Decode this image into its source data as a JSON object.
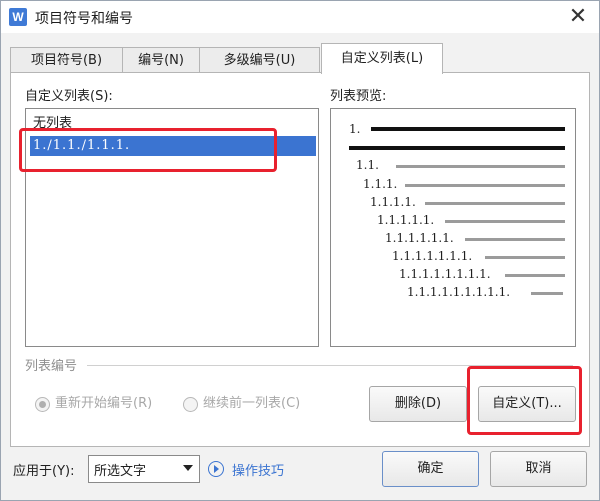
{
  "window": {
    "title": "项目符号和编号",
    "app_icon_letter": "W",
    "close_symbol": "✕"
  },
  "tabs": [
    {
      "label": "项目符号(B)"
    },
    {
      "label": "编号(N)"
    },
    {
      "label": "多级编号(U)"
    },
    {
      "label": "自定义列表(L)",
      "active": true
    }
  ],
  "custom_list": {
    "label": "自定义列表(S):",
    "items": [
      {
        "text": "无列表",
        "selected": false
      },
      {
        "text": "1./1.1./1.1.1.",
        "selected": true
      }
    ]
  },
  "preview": {
    "label": "列表预览:",
    "lines": [
      "1.",
      "",
      "1.1.",
      "1.1.1.",
      "1.1.1.1.",
      "1.1.1.1.1.",
      "1.1.1.1.1.1.",
      "1.1.1.1.1.1.1.",
      "1.1.1.1.1.1.1.1.",
      "1.1.1.1.1.1.1.1.1."
    ]
  },
  "list_numbering": {
    "label": "列表编号",
    "restart_label": "重新开始编号(R)",
    "continue_label": "继续前一列表(C)",
    "restart_checked": true,
    "disabled": true
  },
  "buttons": {
    "delete": "删除(D)",
    "customize": "自定义(T)...",
    "ok": "确定",
    "cancel": "取消"
  },
  "apply_to": {
    "label": "应用于(Y):",
    "value": "所选文字"
  },
  "tips_link": "操作技巧",
  "colors": {
    "highlight": "#e8212e",
    "selection": "#3b74d1",
    "link": "#3b74d1"
  }
}
